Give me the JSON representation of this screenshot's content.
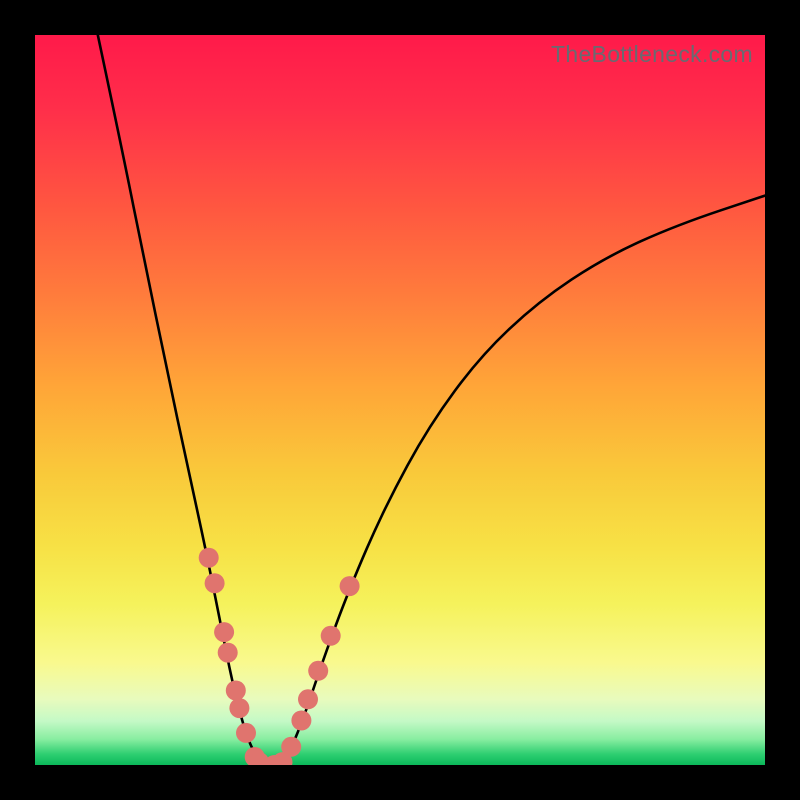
{
  "watermark": "TheBottleneck.com",
  "colors": {
    "curve_stroke": "#000000",
    "dot_fill": "#e0746e",
    "background": "#000000"
  },
  "chart_data": {
    "type": "line",
    "title": "",
    "xlabel": "",
    "ylabel": "",
    "xlim": [
      0,
      100
    ],
    "ylim": [
      0,
      100
    ],
    "series": [
      {
        "name": "bottleneck-curve",
        "description": "V-shaped bottleneck curve; left branch steep descent, right branch rising concave",
        "points": [
          {
            "x_pct": 8.6,
            "y_pct": 100.0
          },
          {
            "x_pct": 12.0,
            "y_pct": 84.0
          },
          {
            "x_pct": 15.0,
            "y_pct": 69.0
          },
          {
            "x_pct": 18.0,
            "y_pct": 54.5
          },
          {
            "x_pct": 21.0,
            "y_pct": 40.5
          },
          {
            "x_pct": 23.5,
            "y_pct": 29.0
          },
          {
            "x_pct": 25.5,
            "y_pct": 19.0
          },
          {
            "x_pct": 27.0,
            "y_pct": 11.5
          },
          {
            "x_pct": 28.5,
            "y_pct": 5.5
          },
          {
            "x_pct": 30.0,
            "y_pct": 1.5
          },
          {
            "x_pct": 31.5,
            "y_pct": 0.3
          },
          {
            "x_pct": 33.5,
            "y_pct": 0.3
          },
          {
            "x_pct": 35.0,
            "y_pct": 2.0
          },
          {
            "x_pct": 37.0,
            "y_pct": 7.0
          },
          {
            "x_pct": 39.5,
            "y_pct": 14.5
          },
          {
            "x_pct": 43.0,
            "y_pct": 24.0
          },
          {
            "x_pct": 48.0,
            "y_pct": 35.5
          },
          {
            "x_pct": 54.0,
            "y_pct": 46.5
          },
          {
            "x_pct": 61.0,
            "y_pct": 56.0
          },
          {
            "x_pct": 69.0,
            "y_pct": 63.5
          },
          {
            "x_pct": 78.0,
            "y_pct": 69.5
          },
          {
            "x_pct": 88.0,
            "y_pct": 74.0
          },
          {
            "x_pct": 100.0,
            "y_pct": 78.0
          }
        ]
      }
    ],
    "overlay_points": {
      "name": "data-dots",
      "fill": "#e0746e",
      "radius_px": 10,
      "points": [
        {
          "x_pct": 23.8,
          "y_pct": 28.4
        },
        {
          "x_pct": 24.6,
          "y_pct": 24.9
        },
        {
          "x_pct": 25.9,
          "y_pct": 18.2
        },
        {
          "x_pct": 26.4,
          "y_pct": 15.4
        },
        {
          "x_pct": 27.5,
          "y_pct": 10.2
        },
        {
          "x_pct": 28.0,
          "y_pct": 7.8
        },
        {
          "x_pct": 28.9,
          "y_pct": 4.4
        },
        {
          "x_pct": 30.1,
          "y_pct": 1.1
        },
        {
          "x_pct": 30.7,
          "y_pct": 0.4
        },
        {
          "x_pct": 32.8,
          "y_pct": 0.0
        },
        {
          "x_pct": 33.9,
          "y_pct": 0.4
        },
        {
          "x_pct": 35.1,
          "y_pct": 2.5
        },
        {
          "x_pct": 36.5,
          "y_pct": 6.1
        },
        {
          "x_pct": 37.4,
          "y_pct": 9.0
        },
        {
          "x_pct": 38.8,
          "y_pct": 12.9
        },
        {
          "x_pct": 40.5,
          "y_pct": 17.7
        },
        {
          "x_pct": 43.1,
          "y_pct": 24.5
        }
      ]
    }
  }
}
